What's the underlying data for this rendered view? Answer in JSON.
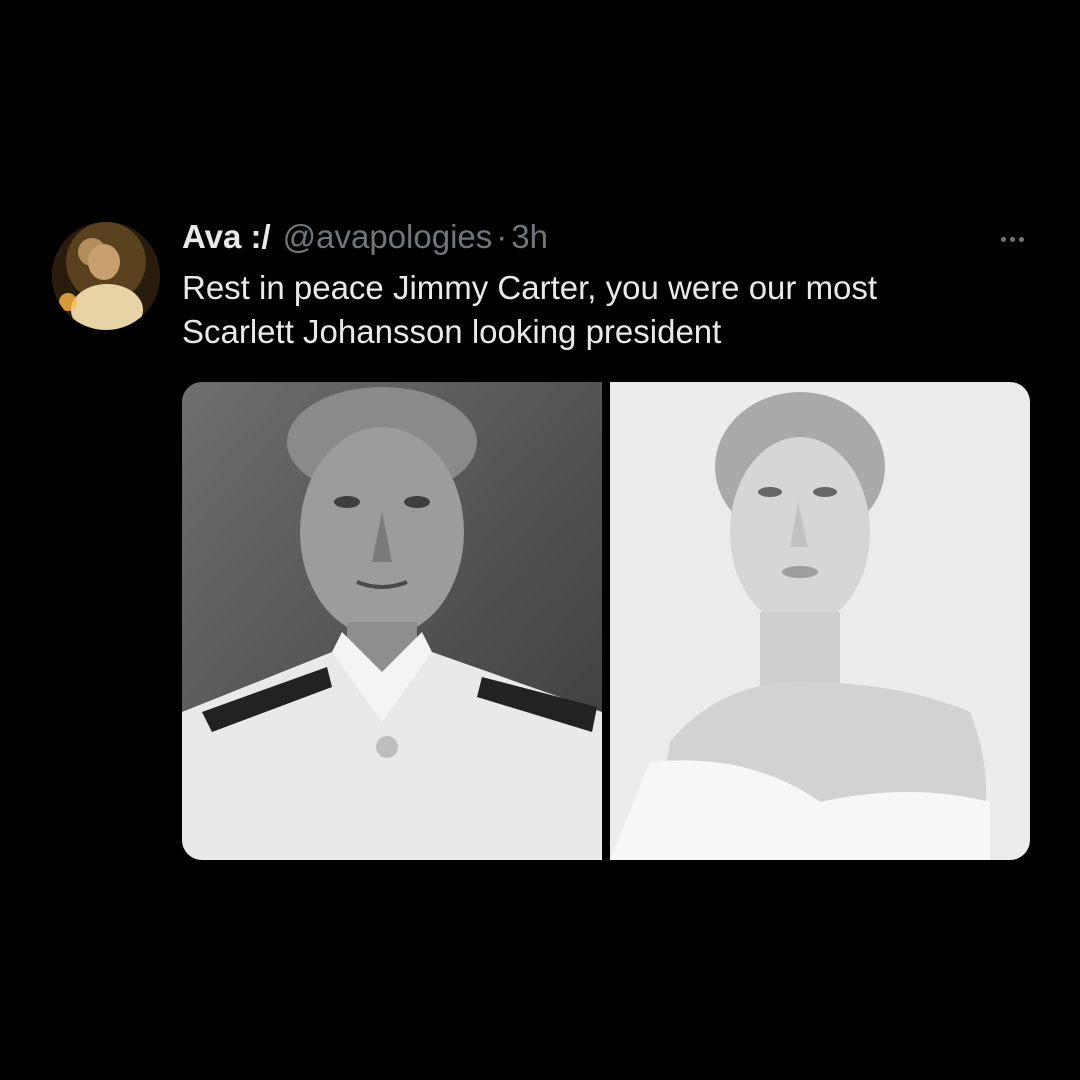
{
  "tweet": {
    "author": {
      "display_name": "Ava :/",
      "handle": "@avapologies",
      "separator": "·",
      "timestamp": "3h"
    },
    "text_lines": [
      "Rest in peace Jimmy Carter, you were our most",
      "Scarlett Johansson looking president"
    ],
    "more_icon": "more-horizontal-icon",
    "media": [
      {
        "kind": "photo",
        "description_icon": "portrait-photo"
      },
      {
        "kind": "photo",
        "description_icon": "portrait-photo"
      }
    ]
  },
  "colors": {
    "background": "#000000",
    "primary_text": "#e7e9ea",
    "secondary_text": "#71767b"
  }
}
